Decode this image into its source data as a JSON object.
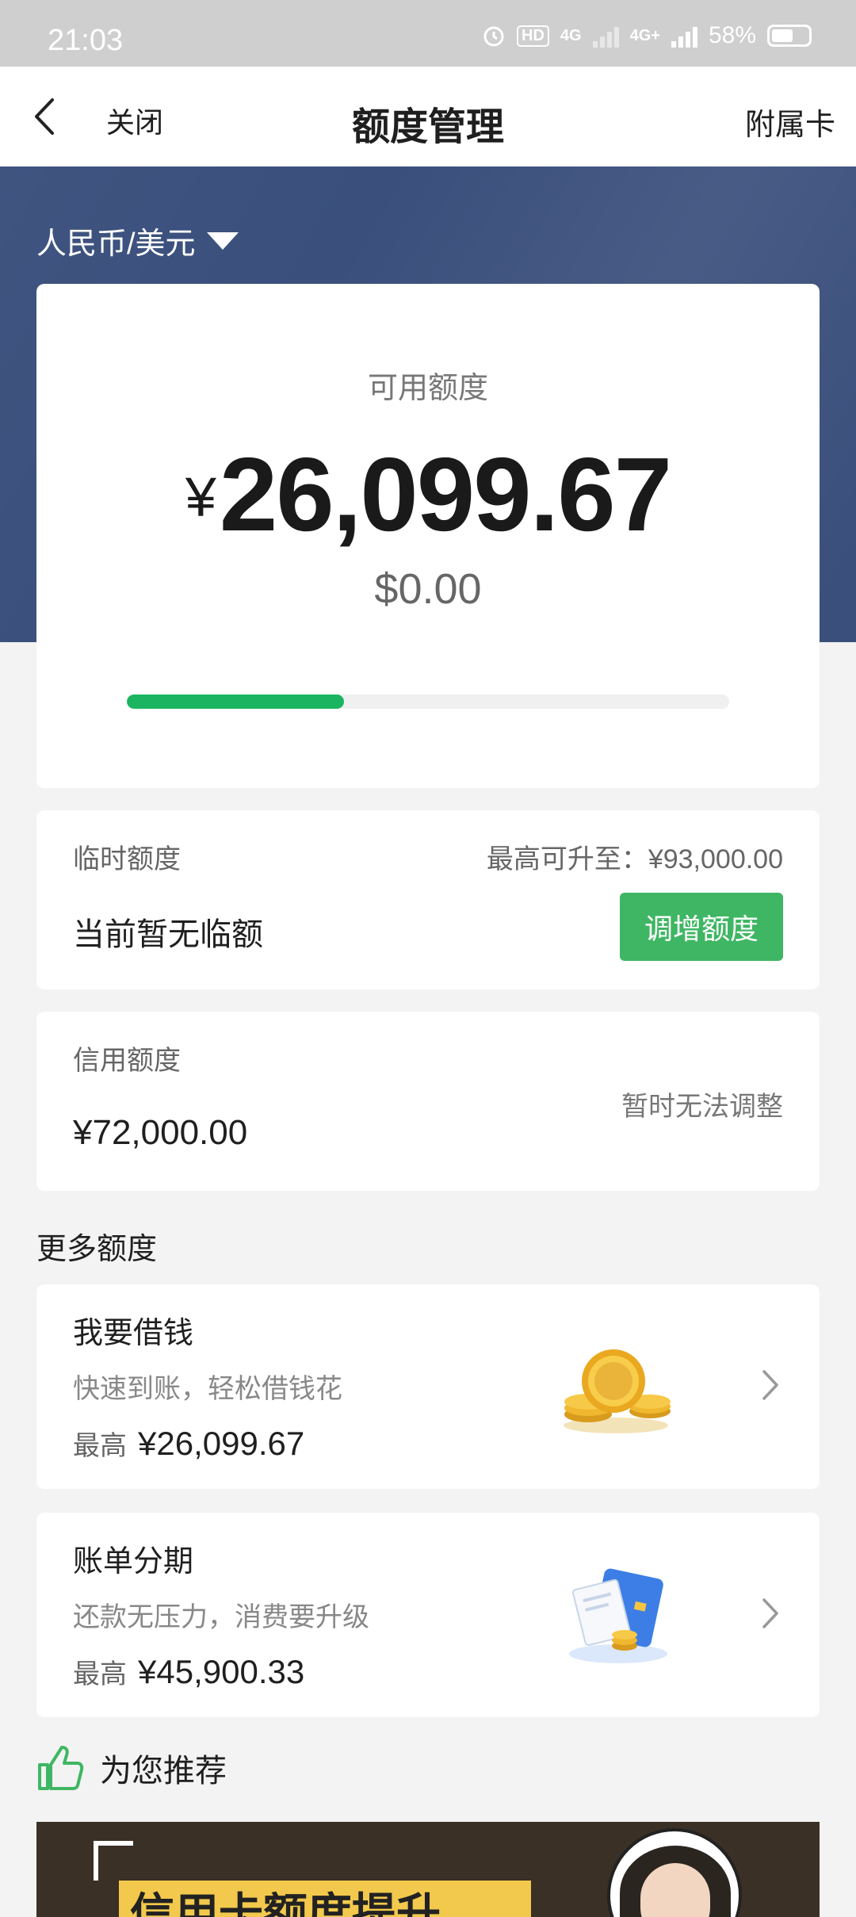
{
  "status_bar": {
    "time": "21:03",
    "network_1": "4G",
    "network_2": "4G+",
    "battery": "58%",
    "hd_badge": "HD"
  },
  "nav": {
    "back_icon": "chevron-left-icon",
    "close_label": "关闭",
    "title": "额度管理",
    "subcard_label": "附属卡"
  },
  "currency_selector": {
    "label": "人民币/美元"
  },
  "available": {
    "label": "可用额度",
    "symbol": "¥",
    "amount": "26,099.67",
    "usd": "$0.00",
    "used_fraction": 0.36,
    "progress_color": "#1bb561"
  },
  "temporary": {
    "label": "临时额度",
    "max_text": "最高可升至：¥93,000.00",
    "status": "当前暂无临额",
    "button_label": "调增额度",
    "button_color": "#3fb663"
  },
  "credit": {
    "label": "信用额度",
    "value": "¥72,000.00",
    "note": "暂时无法调整"
  },
  "more": {
    "title": "更多额度",
    "items": [
      {
        "title": "我要借钱",
        "desc": "快速到账，轻松借钱花",
        "max_label": "最高",
        "max_value": "¥26,099.67",
        "icon": "gold-coins-icon"
      },
      {
        "title": "账单分期",
        "desc": "还款无压力，消费要升级",
        "max_label": "最高",
        "max_value": "¥45,900.33",
        "icon": "bill-card-coins-icon"
      }
    ]
  },
  "recommend": {
    "title": "为您推荐",
    "icon": "thumbs-up-icon",
    "banner_text": "信用卡额度提升"
  },
  "colors": {
    "hero_bg": "#3a4f7c",
    "page_bg": "#f3f3f3"
  }
}
